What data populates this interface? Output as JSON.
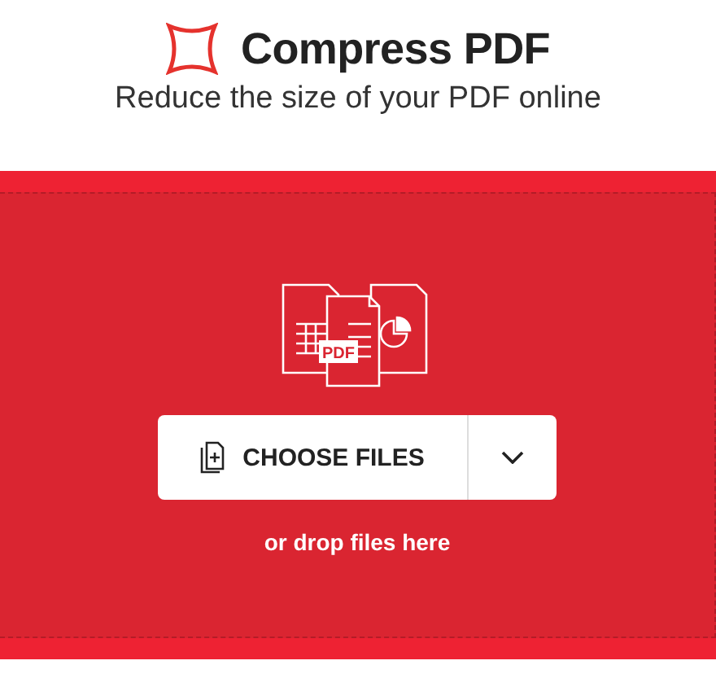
{
  "header": {
    "title": "Compress PDF",
    "subtitle": "Reduce the size of your PDF online"
  },
  "upload": {
    "illustration_label": "PDF",
    "button": "CHOOSE FILES",
    "hint": "or drop files here"
  }
}
